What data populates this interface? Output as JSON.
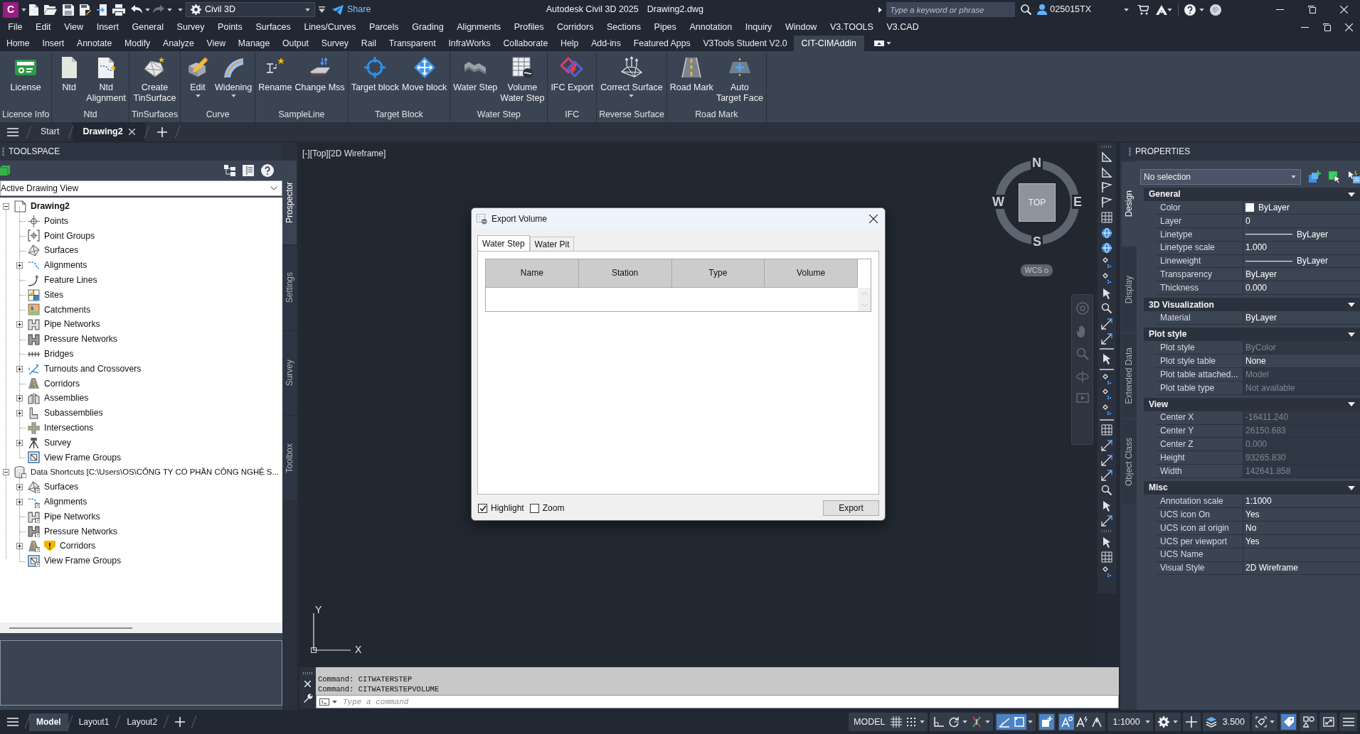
{
  "title_bar": {
    "app_letter": "C",
    "undo": {
      "disabled": false
    },
    "redo": {
      "disabled": true
    },
    "workspace": "Civil 3D",
    "share": "Share",
    "title": "Autodesk Civil 3D 2025",
    "file_name": "Drawing2.dwg",
    "search": {
      "placeholder": "Type a keyword or phrase"
    },
    "user": "025015TX"
  },
  "menu_bar": [
    "File",
    "Edit",
    "View",
    "Insert",
    "General",
    "Survey",
    "Points",
    "Surfaces",
    "Lines/Curves",
    "Parcels",
    "Grading",
    "Alignments",
    "Profiles",
    "Corridors",
    "Sections",
    "Pipes",
    "Annotation",
    "Inquiry",
    "Window",
    "V3.TOOLS",
    "V3.CAD"
  ],
  "ribbon_tabs": [
    {
      "label": "Home",
      "selected": false
    },
    {
      "label": "Insert",
      "selected": false
    },
    {
      "label": "Annotate",
      "selected": false
    },
    {
      "label": "Modify",
      "selected": false
    },
    {
      "label": "Analyze",
      "selected": false
    },
    {
      "label": "View",
      "selected": false
    },
    {
      "label": "Manage",
      "selected": false
    },
    {
      "label": "Output",
      "selected": false
    },
    {
      "label": "Survey",
      "selected": false
    },
    {
      "label": "Rail",
      "selected": false
    },
    {
      "label": "Transparent",
      "selected": false
    },
    {
      "label": "InfraWorks",
      "selected": false
    },
    {
      "label": "Collaborate",
      "selected": false
    },
    {
      "label": "Help",
      "selected": false
    },
    {
      "label": "Add-ins",
      "selected": false
    },
    {
      "label": "Featured Apps",
      "selected": false
    },
    {
      "label": "V3Tools Student V2.0",
      "selected": false
    },
    {
      "label": "CIT-CIMAddin",
      "selected": true
    }
  ],
  "ribbon_panels": [
    {
      "label": "Licence Info",
      "buttons": [
        {
          "label": "License"
        }
      ]
    },
    {
      "label": "Ntd",
      "buttons": [
        {
          "label": "Ntd"
        },
        {
          "label": "Ntd\nAlignment"
        }
      ]
    },
    {
      "label": "TinSurfaces",
      "buttons": [
        {
          "label": "Create\nTinSurface"
        }
      ]
    },
    {
      "label": "Curve",
      "buttons": [
        {
          "label": "Edit",
          "dropdown": true
        },
        {
          "label": "Widening",
          "dropdown": true
        }
      ]
    },
    {
      "label": "SampleLine",
      "buttons": [
        {
          "label": "Rename"
        },
        {
          "label": "Change Mss"
        }
      ]
    },
    {
      "label": "Target Block",
      "buttons": [
        {
          "label": "Target block"
        },
        {
          "label": "Move block"
        }
      ]
    },
    {
      "label": "Water Step",
      "buttons": [
        {
          "label": "Water Step"
        },
        {
          "label": "Volume\nWater Step"
        }
      ]
    },
    {
      "label": "IFC",
      "buttons": [
        {
          "label": "IFC Export"
        }
      ]
    },
    {
      "label": "Reverse Surface",
      "buttons": [
        {
          "label": "Correct Surface",
          "dropdown": true
        }
      ]
    },
    {
      "label": "Road Mark",
      "buttons": [
        {
          "label": "Road Mark"
        },
        {
          "label": "Auto\nTarget Face"
        }
      ]
    }
  ],
  "file_tabs": [
    {
      "label": "Start",
      "selected": false
    },
    {
      "label": "Drawing2",
      "selected": true
    }
  ],
  "toolspace": {
    "title": "TOOLSPACE",
    "view": "Active Drawing View",
    "tree": [
      {
        "label": "Drawing2",
        "kind": "branch",
        "expanded": true,
        "active": true,
        "children": [
          {
            "label": "Points",
            "kind": "leaf"
          },
          {
            "label": "Point Groups",
            "kind": "leaf"
          },
          {
            "label": "Surfaces",
            "kind": "leaf"
          },
          {
            "label": "Alignments",
            "kind": "branch",
            "expanded": false
          },
          {
            "label": "Feature Lines",
            "kind": "leaf"
          },
          {
            "label": "Sites",
            "kind": "leaf"
          },
          {
            "label": "Catchments",
            "kind": "leaf"
          },
          {
            "label": "Pipe Networks",
            "kind": "branch",
            "expanded": false
          },
          {
            "label": "Pressure Networks",
            "kind": "leaf"
          },
          {
            "label": "Bridges",
            "kind": "leaf"
          },
          {
            "label": "Turnouts and Crossovers",
            "kind": "branch",
            "expanded": false
          },
          {
            "label": "Corridors",
            "kind": "leaf"
          },
          {
            "label": "Assemblies",
            "kind": "branch",
            "expanded": false
          },
          {
            "label": "Subassemblies",
            "kind": "branch",
            "expanded": false
          },
          {
            "label": "Intersections",
            "kind": "leaf"
          },
          {
            "label": "Survey",
            "kind": "branch",
            "expanded": false
          },
          {
            "label": "View Frame Groups",
            "kind": "leaf"
          }
        ]
      },
      {
        "label": "Data Shortcuts [C:\\Users\\OS\\CÔNG TY CỔ PHẦN CÔNG NGHỆ S...",
        "kind": "branch",
        "expanded": true,
        "active": false,
        "children": [
          {
            "label": "Surfaces",
            "kind": "branch",
            "expanded": false
          },
          {
            "label": "Alignments",
            "kind": "branch",
            "expanded": false
          },
          {
            "label": "Pipe Networks",
            "kind": "leaf"
          },
          {
            "label": "Pressure Networks",
            "kind": "leaf"
          },
          {
            "label": "Corridors",
            "kind": "branch",
            "expanded": false,
            "warning": true
          },
          {
            "label": "View Frame Groups",
            "kind": "leaf"
          }
        ]
      }
    ],
    "side_tabs": [
      {
        "label": "Prospector",
        "selected": true
      },
      {
        "label": "Settings",
        "selected": false
      },
      {
        "label": "Survey",
        "selected": false
      },
      {
        "label": "Toolbox",
        "selected": false
      }
    ]
  },
  "viewport": {
    "controls": [
      "[-]",
      "[Top]",
      "[2D Wireframe]"
    ],
    "viewcube": {
      "face": "TOP",
      "north": "N",
      "south": "S",
      "west": "W",
      "east": "E",
      "coordinate_system": "WCS"
    },
    "ucs_axes": {
      "x": "X",
      "y": "Y"
    }
  },
  "dialog": {
    "title": "Export Volume",
    "tabs": [
      {
        "label": "Water Step",
        "selected": true
      },
      {
        "label": "Water Pit",
        "selected": false
      }
    ],
    "table": {
      "columns": [
        "Name",
        "Station",
        "Type",
        "Volume"
      ]
    },
    "options": [
      {
        "label": "Highlight",
        "checked": true
      },
      {
        "label": "Zoom",
        "checked": false
      }
    ],
    "buttons": [
      "Export"
    ]
  },
  "properties": {
    "title": "PROPERTIES",
    "selection": "No selection",
    "side_tabs": [
      {
        "label": "Design",
        "selected": true
      },
      {
        "label": "Display",
        "selected": false
      },
      {
        "label": "Extended Data",
        "selected": false
      },
      {
        "label": "Object Class",
        "selected": false
      }
    ],
    "sections": [
      {
        "title": "General",
        "expanded": true,
        "rows": [
          {
            "label": "Color",
            "value": "ByLayer",
            "kind": "color",
            "color": "#ffffff",
            "readonly": false
          },
          {
            "label": "Layer",
            "value": "0",
            "kind": "text",
            "readonly": false
          },
          {
            "label": "Linetype",
            "value": "ByLayer",
            "kind": "line",
            "readonly": false
          },
          {
            "label": "Linetype scale",
            "value": "1.000",
            "kind": "text",
            "readonly": false
          },
          {
            "label": "Lineweight",
            "value": "ByLayer",
            "kind": "line",
            "readonly": false
          },
          {
            "label": "Transparency",
            "value": "ByLayer",
            "kind": "text",
            "readonly": false
          },
          {
            "label": "Thickness",
            "value": "0.000",
            "kind": "text",
            "readonly": false
          }
        ]
      },
      {
        "title": "3D Visualization",
        "expanded": true,
        "rows": [
          {
            "label": "Material",
            "value": "ByLayer",
            "kind": "text",
            "readonly": false
          }
        ]
      },
      {
        "title": "Plot style",
        "expanded": true,
        "rows": [
          {
            "label": "Plot style",
            "value": "ByColor",
            "kind": "text",
            "readonly": true
          },
          {
            "label": "Plot style table",
            "value": "None",
            "kind": "text",
            "readonly": false
          },
          {
            "label": "Plot table attached...",
            "value": "Model",
            "kind": "text",
            "readonly": true
          },
          {
            "label": "Plot table type",
            "value": "Not available",
            "kind": "text",
            "readonly": true
          }
        ]
      },
      {
        "title": "View",
        "expanded": true,
        "rows": [
          {
            "label": "Center X",
            "value": "-16411.240",
            "kind": "text",
            "readonly": true
          },
          {
            "label": "Center Y",
            "value": "26150.683",
            "kind": "text",
            "readonly": true
          },
          {
            "label": "Center Z",
            "value": "0.000",
            "kind": "text",
            "readonly": true
          },
          {
            "label": "Height",
            "value": "93265.830",
            "kind": "text",
            "readonly": true
          },
          {
            "label": "Width",
            "value": "142641.858",
            "kind": "text",
            "readonly": true
          }
        ]
      },
      {
        "title": "Misc",
        "expanded": true,
        "rows": [
          {
            "label": "Annotation scale",
            "value": "1:1000",
            "kind": "text",
            "readonly": false
          },
          {
            "label": "UCS icon On",
            "value": "Yes",
            "kind": "text",
            "readonly": false
          },
          {
            "label": "UCS icon at origin",
            "value": "No",
            "kind": "text",
            "readonly": false
          },
          {
            "label": "UCS per viewport",
            "value": "Yes",
            "kind": "text",
            "readonly": false
          },
          {
            "label": "UCS Name",
            "kind": "text",
            "readonly": false
          },
          {
            "label": "Visual Style",
            "value": "2D Wireframe",
            "kind": "text",
            "readonly": false
          }
        ]
      }
    ]
  },
  "command_line": {
    "history": [
      "Command: CITWATERSTEP",
      "Command: CITWATERSTEPVOLUME"
    ],
    "placeholder": "Type a command"
  },
  "status_bar": {
    "layout_tabs": [
      {
        "label": "Model",
        "selected": true
      },
      {
        "label": "Layout1",
        "selected": false
      },
      {
        "label": "Layout2",
        "selected": false
      }
    ],
    "items": [
      {
        "kind": "label",
        "text": "MODEL"
      },
      {
        "kind": "toggle",
        "on": false
      },
      {
        "kind": "toggle",
        "on": false,
        "dropdown": true
      },
      {
        "kind": "toggle",
        "on": false
      },
      {
        "kind": "toggle",
        "on": false,
        "dropdown": true
      },
      {
        "kind": "toggle",
        "on": false,
        "dropdown": true
      },
      {
        "kind": "toggle",
        "on": true
      },
      {
        "kind": "toggle",
        "on": true,
        "dropdown": true
      },
      {
        "kind": "toggle",
        "on": true
      },
      {
        "kind": "toggle",
        "on": true
      },
      {
        "kind": "toggle",
        "on": false
      },
      {
        "kind": "toggle",
        "on": false
      },
      {
        "kind": "label",
        "text": "1:1000",
        "dropdown": true
      },
      {
        "kind": "toggle",
        "on": false,
        "dropdown": true
      },
      {
        "kind": "toggle",
        "on": false
      },
      {
        "kind": "toggle",
        "on": false
      },
      {
        "kind": "label",
        "text": "3.500"
      },
      {
        "kind": "toggle",
        "on": false,
        "dropdown": true
      },
      {
        "kind": "toggle",
        "on": true
      },
      {
        "kind": "toggle",
        "on": false
      },
      {
        "kind": "toggle",
        "on": false
      },
      {
        "kind": "toggle",
        "on": false
      }
    ]
  }
}
